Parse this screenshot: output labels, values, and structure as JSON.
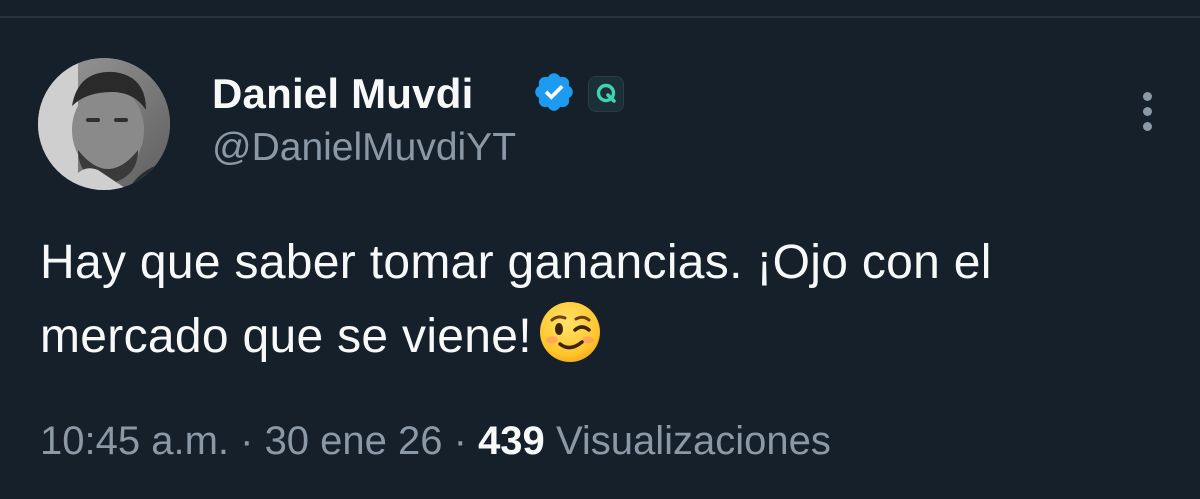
{
  "tweet": {
    "author": {
      "display_name": "Daniel Muvdi",
      "handle": "@DanielMuvdiYT",
      "verified": true,
      "verified_badge_icon": "verified-check-icon",
      "affiliate_badge_icon": "q-affiliate-icon",
      "avatar_description": "grayscale portrait photo"
    },
    "text": "Hay que saber tomar ganancias. ¡Ojo con el mercado que se viene!",
    "emoji": "winking-face-emoji",
    "meta": {
      "time": "10:45 a.m.",
      "separator": " · ",
      "date": "30 ene 26",
      "views_count": "439",
      "views_label": "Visualizaciones"
    }
  },
  "colors": {
    "background": "#15202b",
    "primary_text": "#f7f9f9",
    "secondary_text": "#8b98a5",
    "verified_blue": "#1d9bf0",
    "affiliate_teal": "#3fd3b4"
  }
}
